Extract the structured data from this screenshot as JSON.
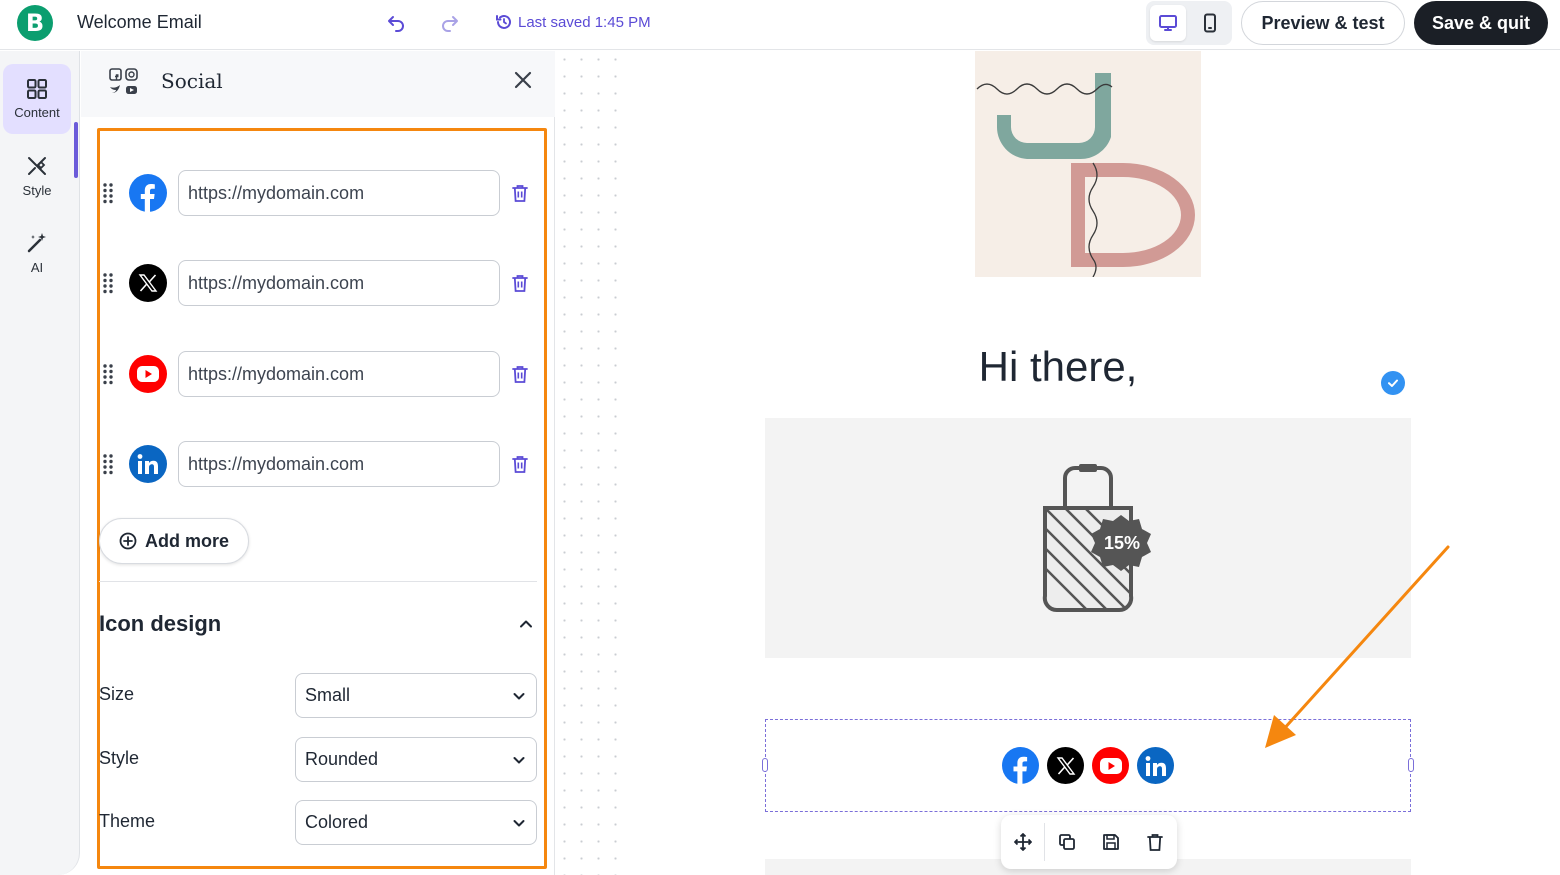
{
  "header": {
    "logo_letter": "B",
    "doc_title": "Welcome Email",
    "last_saved": "Last saved 1:45 PM",
    "preview_label": "Preview & test",
    "save_label": "Save & quit"
  },
  "rail": {
    "items": [
      {
        "label": "Content",
        "icon": "grid-icon",
        "active": true
      },
      {
        "label": "Style",
        "icon": "brush-icon",
        "active": false
      },
      {
        "label": "AI",
        "icon": "magic-wand-icon",
        "active": false
      }
    ]
  },
  "panel": {
    "title": "Social",
    "social_links": [
      {
        "network": "facebook",
        "icon": "facebook-icon",
        "url": "https://mydomain.com",
        "color": "#1877f2"
      },
      {
        "network": "x",
        "icon": "x-icon",
        "url": "https://mydomain.com",
        "color": "#000000"
      },
      {
        "network": "youtube",
        "icon": "youtube-icon",
        "url": "https://mydomain.com",
        "color": "#ff0000"
      },
      {
        "network": "linkedin",
        "icon": "linkedin-icon",
        "url": "https://mydomain.com",
        "color": "#0a66c2"
      }
    ],
    "add_more_label": "Add more",
    "icon_design": {
      "title": "Icon design",
      "fields": [
        {
          "label": "Size",
          "value": "Small"
        },
        {
          "label": "Style",
          "value": "Rounded"
        },
        {
          "label": "Theme",
          "value": "Colored"
        }
      ]
    }
  },
  "canvas": {
    "greeting": "Hi there,",
    "discount_badge": "15%"
  },
  "colors": {
    "accent": "#6b5bd9",
    "highlight": "#f5870f",
    "brand_green": "#0b9e6f"
  }
}
